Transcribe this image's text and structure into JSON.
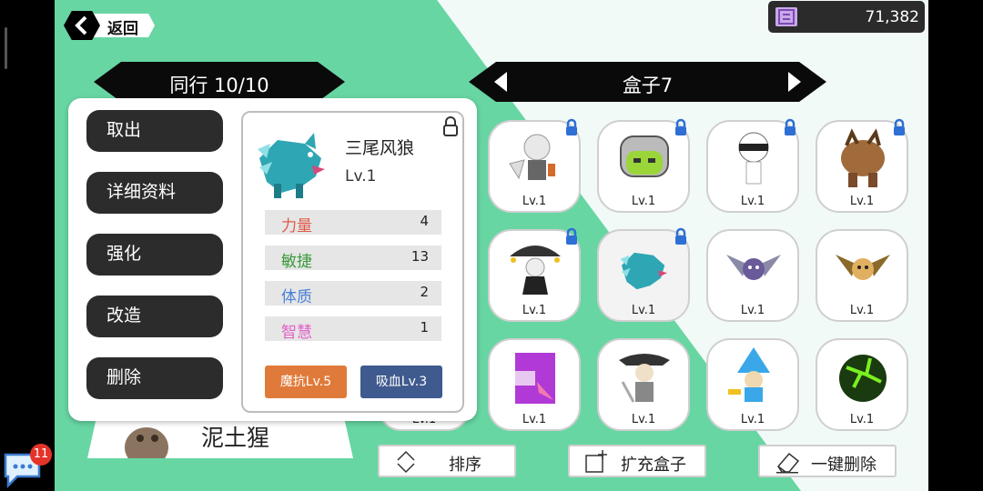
{
  "top": {
    "back_label": "返回",
    "currency_value": "71,382"
  },
  "party_banner": {
    "title": "同行 10/10"
  },
  "box_banner": {
    "title": "盒子7"
  },
  "actions": [
    "取出",
    "详细资料",
    "强化",
    "改造",
    "删除"
  ],
  "card": {
    "name": "三尾风狼",
    "level": "Lv.1",
    "stats": [
      {
        "name": "力量",
        "value": "4",
        "color": "#e05a4a"
      },
      {
        "name": "敏捷",
        "value": "13",
        "color": "#3a9a3a"
      },
      {
        "name": "体质",
        "value": "2",
        "color": "#4a7fd6"
      },
      {
        "name": "智慧",
        "value": "1",
        "color": "#e060c8"
      }
    ],
    "skills": [
      {
        "label": "魔抗Lv.5",
        "color": "#e07a3a"
      },
      {
        "label": "吸血Lv.3",
        "color": "#3f5a8e"
      }
    ]
  },
  "grid": [
    {
      "level": "Lv.1",
      "locked": true,
      "icon": "white-hair-swordsman-icon"
    },
    {
      "level": "Lv.1",
      "locked": true,
      "icon": "helmet-goblin-icon"
    },
    {
      "level": "Lv.1",
      "locked": true,
      "icon": "white-masked-figure-icon"
    },
    {
      "level": "Lv.1",
      "locked": true,
      "icon": "rock-golem-icon"
    },
    {
      "level": "Lv.1",
      "locked": true,
      "icon": "umbrella-girl-icon"
    },
    {
      "level": "Lv.1",
      "locked": true,
      "icon": "three-tailed-wolf-icon"
    },
    {
      "level": "Lv.1",
      "locked": false,
      "icon": "purple-bat-icon"
    },
    {
      "level": "Lv.1",
      "locked": false,
      "icon": "brown-bat-icon"
    },
    {
      "level": "Lv.1",
      "locked": false,
      "icon": "purple-block-icon"
    },
    {
      "level": "Lv.1",
      "locked": false,
      "icon": "pirate-captain-icon"
    },
    {
      "level": "Lv.1",
      "locked": false,
      "icon": "blue-wizard-icon"
    },
    {
      "level": "Lv.1",
      "locked": false,
      "icon": "green-slime-ball-icon"
    }
  ],
  "hidden_slot_label": "Lv.1",
  "under_card": {
    "name": "泥土猩"
  },
  "bottom": {
    "sort_label": "排序",
    "expand_label": "扩充盒子",
    "delete_label": "一键删除"
  },
  "chat": {
    "badge": "11"
  }
}
